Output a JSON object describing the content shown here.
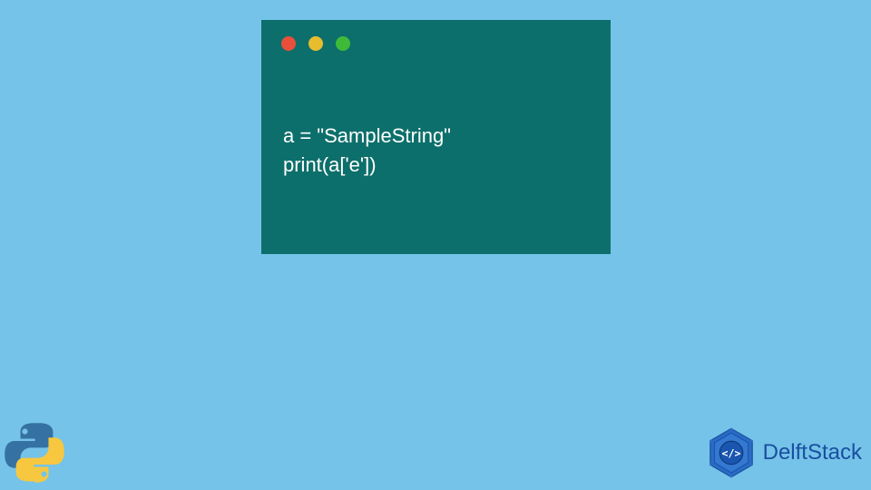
{
  "code": {
    "line1": "a = \"SampleString\"",
    "line2": "print(a['e'])"
  },
  "brand": {
    "name": "DelftStack"
  },
  "colors": {
    "background": "#75c3e8",
    "windowBg": "#0d6f6b",
    "dotRed": "#e94f3a",
    "dotYellow": "#e7bd2f",
    "dotGreen": "#3fba38",
    "brand": "#194fa1",
    "pythonBlue": "#3571a3",
    "pythonYellow": "#f7c83f"
  }
}
